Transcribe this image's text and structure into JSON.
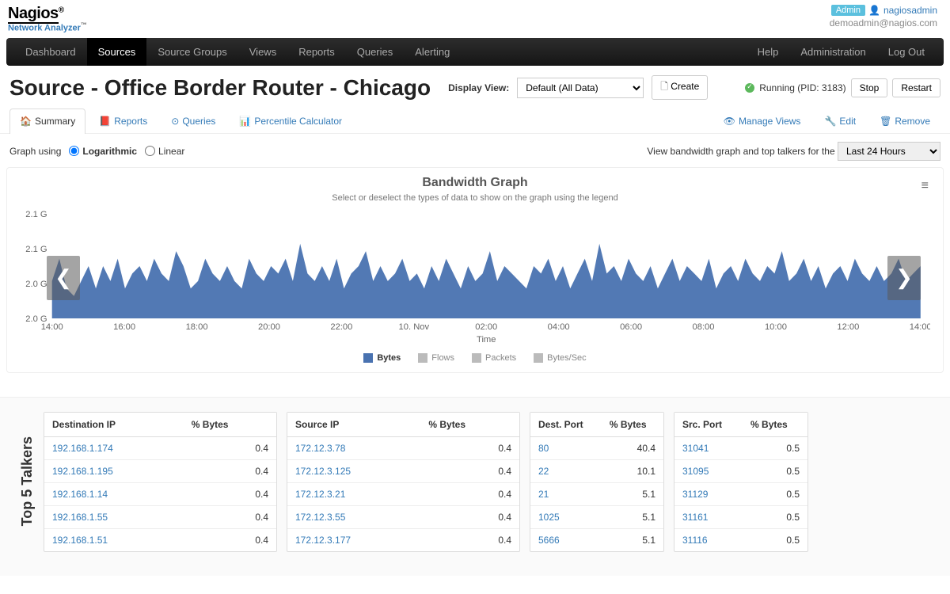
{
  "brand": {
    "main": "Nagios",
    "sub": "Network Analyzer",
    "tm": "™",
    "reg": "®"
  },
  "user": {
    "badge": "Admin",
    "name": "nagiosadmin",
    "email": "demoadmin@nagios.com"
  },
  "nav": {
    "left": [
      "Dashboard",
      "Sources",
      "Source Groups",
      "Views",
      "Reports",
      "Queries",
      "Alerting"
    ],
    "right": [
      "Help",
      "Administration",
      "Log Out"
    ],
    "active": "Sources"
  },
  "page": {
    "title": "Source - Office Border Router - Chicago",
    "display_view_label": "Display View:",
    "view_selected": "Default (All Data)",
    "create_label": "Create",
    "status_text": "Running (PID: 3183)",
    "stop_label": "Stop",
    "restart_label": "Restart"
  },
  "subtabs": {
    "left": [
      {
        "icon": "🏠",
        "label": "Summary",
        "active": true
      },
      {
        "icon": "📕",
        "label": "Reports"
      },
      {
        "icon": "⊙",
        "label": "Queries"
      },
      {
        "icon": "📊",
        "label": "Percentile Calculator"
      }
    ],
    "right": [
      {
        "icon": "👁",
        "label": "Manage Views"
      },
      {
        "icon": "🔧",
        "label": "Edit"
      },
      {
        "icon": "🗑",
        "label": "Remove"
      }
    ]
  },
  "graph_opts": {
    "using_label": "Graph using",
    "log_label": "Logarithmic",
    "lin_label": "Linear",
    "range_label": "View bandwidth graph and top talkers for the",
    "range_selected": "Last 24 Hours"
  },
  "chart_data": {
    "type": "area",
    "title": "Bandwidth Graph",
    "subtitle": "Select or deselect the types of data to show on the graph using the legend",
    "xlabel": "Time",
    "y_ticks": [
      "2.1 G",
      "2.1 G",
      "2.0 G",
      "2.0 G"
    ],
    "x_ticks": [
      "14:00",
      "16:00",
      "18:00",
      "20:00",
      "22:00",
      "10. Nov",
      "02:00",
      "04:00",
      "06:00",
      "08:00",
      "10:00",
      "12:00",
      "14:00"
    ],
    "legend": [
      {
        "name": "Bytes",
        "color": "#4972b0",
        "active": true
      },
      {
        "name": "Flows",
        "color": "#bbbbbb",
        "active": false
      },
      {
        "name": "Packets",
        "color": "#bbbbbb",
        "active": false
      },
      {
        "name": "Bytes/Sec",
        "color": "#bbbbbb",
        "active": false
      }
    ],
    "ylim_g": [
      1.98,
      2.12
    ],
    "series": [
      {
        "name": "Bytes",
        "values_g": [
          2.03,
          2.06,
          2.02,
          2.01,
          2.03,
          2.05,
          2.02,
          2.05,
          2.03,
          2.06,
          2.02,
          2.04,
          2.05,
          2.03,
          2.06,
          2.04,
          2.03,
          2.07,
          2.05,
          2.02,
          2.03,
          2.06,
          2.04,
          2.03,
          2.05,
          2.03,
          2.02,
          2.06,
          2.04,
          2.03,
          2.05,
          2.04,
          2.06,
          2.03,
          2.08,
          2.04,
          2.03,
          2.05,
          2.03,
          2.06,
          2.02,
          2.04,
          2.05,
          2.07,
          2.03,
          2.05,
          2.03,
          2.04,
          2.06,
          2.03,
          2.04,
          2.02,
          2.05,
          2.03,
          2.06,
          2.04,
          2.02,
          2.05,
          2.03,
          2.04,
          2.07,
          2.03,
          2.05,
          2.04,
          2.03,
          2.02,
          2.05,
          2.04,
          2.06,
          2.03,
          2.05,
          2.02,
          2.04,
          2.06,
          2.03,
          2.08,
          2.04,
          2.05,
          2.03,
          2.06,
          2.04,
          2.03,
          2.05,
          2.02,
          2.04,
          2.06,
          2.03,
          2.05,
          2.04,
          2.03,
          2.06,
          2.02,
          2.04,
          2.05,
          2.03,
          2.06,
          2.04,
          2.03,
          2.05,
          2.04,
          2.07,
          2.03,
          2.04,
          2.06,
          2.03,
          2.05,
          2.02,
          2.04,
          2.05,
          2.03,
          2.06,
          2.04,
          2.03,
          2.05,
          2.03,
          2.04,
          2.06,
          2.03,
          2.04,
          2.05
        ]
      }
    ]
  },
  "top5_label": "Top 5 Talkers",
  "tables": {
    "dest_ip": {
      "headers": [
        "Destination IP",
        "% Bytes"
      ],
      "rows": [
        [
          "192.168.1.174",
          "0.4"
        ],
        [
          "192.168.1.195",
          "0.4"
        ],
        [
          "192.168.1.14",
          "0.4"
        ],
        [
          "192.168.1.55",
          "0.4"
        ],
        [
          "192.168.1.51",
          "0.4"
        ]
      ]
    },
    "src_ip": {
      "headers": [
        "Source IP",
        "% Bytes"
      ],
      "rows": [
        [
          "172.12.3.78",
          "0.4"
        ],
        [
          "172.12.3.125",
          "0.4"
        ],
        [
          "172.12.3.21",
          "0.4"
        ],
        [
          "172.12.3.55",
          "0.4"
        ],
        [
          "172.12.3.177",
          "0.4"
        ]
      ]
    },
    "dst_port": {
      "headers": [
        "Dest. Port",
        "% Bytes"
      ],
      "rows": [
        [
          "80",
          "40.4"
        ],
        [
          "22",
          "10.1"
        ],
        [
          "21",
          "5.1"
        ],
        [
          "1025",
          "5.1"
        ],
        [
          "5666",
          "5.1"
        ]
      ]
    },
    "src_port": {
      "headers": [
        "Src. Port",
        "% Bytes"
      ],
      "rows": [
        [
          "31041",
          "0.5"
        ],
        [
          "31095",
          "0.5"
        ],
        [
          "31129",
          "0.5"
        ],
        [
          "31161",
          "0.5"
        ],
        [
          "31116",
          "0.5"
        ]
      ]
    }
  }
}
